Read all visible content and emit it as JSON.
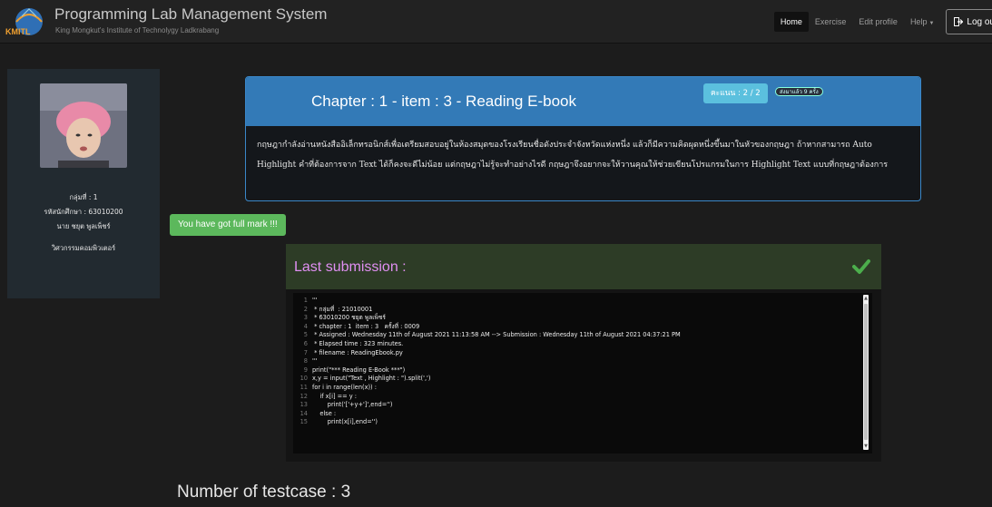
{
  "brand": {
    "logo_text": "KMITL",
    "title": "Programming Lab Management System",
    "subtitle": "King Mongkut's Institute of Technolygy Ladkrabang"
  },
  "nav": {
    "home": "Home",
    "exercise": "Exercise",
    "edit_profile": "Edit profile",
    "help": "Help",
    "logout": "Log ou"
  },
  "sidebar": {
    "avatar_icon": "user-photo",
    "group": "กลุ่มที่ : 1",
    "student_id": "รหัสนักศึกษา : 63010200",
    "name": "นาย ชยุต พูลเพ็ชร์",
    "faculty": "วิศวกรรมคอมพิวเตอร์"
  },
  "chapter": {
    "title": "Chapter : 1 - item : 3 - Reading E-book",
    "score": "คะแนน : 2 / 2",
    "sent": "ส่งมาแล้ว 9 ครั้ง",
    "description": "กฤษฎากำลังอ่านหนังสืออิเล็กทรอนิกส์เพื่อเตรียมสอบอยู่ในห้องสมุดของโรงเรียนชื่อดังประจำจังหวัดแห่งหนึ่ง แล้วก็มีความคิดผุดหนึ่งขึ้นมาในหัวของกฤษฎา ถ้าหากสามารถ Auto Highlight คำที่ต้องการจาก Text ได้ก็คงจะดีไม่น้อย แต่กฤษฎาไม่รู้จะทำอย่างไรดี กฤษฎาจึงอยากจะให้วานคุณให้ช่วยเขียนโปรแกรมในการ Highlight Text แบบที่กฤษฎาต้องการ"
  },
  "fullmark": "You have got full mark !!!",
  "submission": {
    "title": "Last submission :",
    "status_icon": "check-icon",
    "lines": [
      {
        "n": "1",
        "t": "'''"
      },
      {
        "n": "2",
        "t": " * กลุ่มที่  : 21010001"
      },
      {
        "n": "3",
        "t": " * 63010200 ชยุต พูลเพ็ชร์"
      },
      {
        "n": "4",
        "t": " * chapter : 1  item : 3   ครั้งที่ : 0009"
      },
      {
        "n": "5",
        "t": " * Assigned : Wednesday 11th of August 2021 11:13:58 AM --> Submission : Wednesday 11th of August 2021 04:37:21 PM"
      },
      {
        "n": "6",
        "t": " * Elapsed time : 323 minutes."
      },
      {
        "n": "7",
        "t": " * filename : ReadingEbook.py"
      },
      {
        "n": "8",
        "t": "'''"
      },
      {
        "n": "9",
        "t": "print(\"*** Reading E-Book ***\")"
      },
      {
        "n": "10",
        "t": "x,y = input(\"Text , Highlight : \").split(',')"
      },
      {
        "n": "11",
        "t": "for i in range(len(x)) :"
      },
      {
        "n": "12",
        "t": "    if x[i] == y :"
      },
      {
        "n": "13",
        "t": "        print('['+y+']',end='')"
      },
      {
        "n": "14",
        "t": "    else :"
      },
      {
        "n": "15",
        "t": "        print(x[i],end='')"
      }
    ]
  },
  "testcase": "Number of testcase : 3",
  "colors": {
    "panel_header": "#337ab7",
    "score_badge": "#5bc0de",
    "success": "#5cb85c",
    "submission_title": "#e08ff2",
    "check": "#4cae4c"
  }
}
